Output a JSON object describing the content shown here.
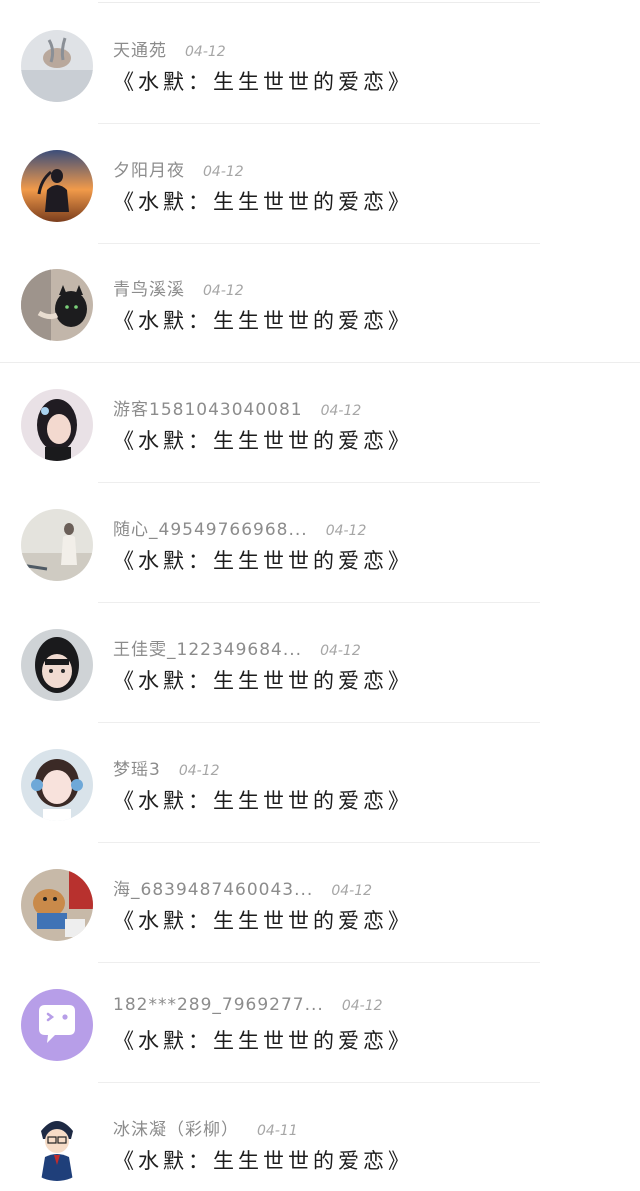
{
  "items": [
    {
      "name": "天通苑",
      "date": "04-12",
      "content": "《水默：生生世世的爱恋》",
      "avatar": "avatar-photo-snow-hands"
    },
    {
      "name": "夕阳月夜",
      "date": "04-12",
      "content": "《水默：生生世世的爱恋》",
      "avatar": "avatar-photo-sunset-girl"
    },
    {
      "name": "青鸟溪溪",
      "date": "04-12",
      "content": "《水默：生生世世的爱恋》",
      "avatar": "avatar-photo-black-cat"
    },
    {
      "name": "游客1581043040081",
      "date": "04-12",
      "content": "《水默：生生世世的爱恋》",
      "avatar": "avatar-photo-girl-hairclip"
    },
    {
      "name": "随心_49549766968...",
      "date": "04-12",
      "content": "《水默：生生世世的爱恋》",
      "avatar": "avatar-photo-girl-sea"
    },
    {
      "name": "王佳雯_122349684...",
      "date": "04-12",
      "content": "《水默：生生世世的爱恋》",
      "avatar": "avatar-photo-girl-face"
    },
    {
      "name": "梦瑶3",
      "date": "04-12",
      "content": "《水默：生生世世的爱恋》",
      "avatar": "avatar-photo-girl-headphones"
    },
    {
      "name": "海_6839487460043...",
      "date": "04-12",
      "content": "《水默：生生世世的爱恋》",
      "avatar": "avatar-photo-toy-dog"
    },
    {
      "name": "182***289_7969277...",
      "date": "04-12",
      "content": "《水默：生生世世的爱恋》",
      "avatar": "avatar-default-chat-bubble"
    },
    {
      "name": "冰沫凝（彩柳）",
      "date": "04-11",
      "content": "《水默：生生世世的爱恋》",
      "avatar": "avatar-anime-boy"
    }
  ],
  "colors": {
    "name": "#8c8c8c",
    "date": "#a6a6a6",
    "content": "#1d1d1d",
    "default_avatar_bg": "#b79ee8"
  }
}
